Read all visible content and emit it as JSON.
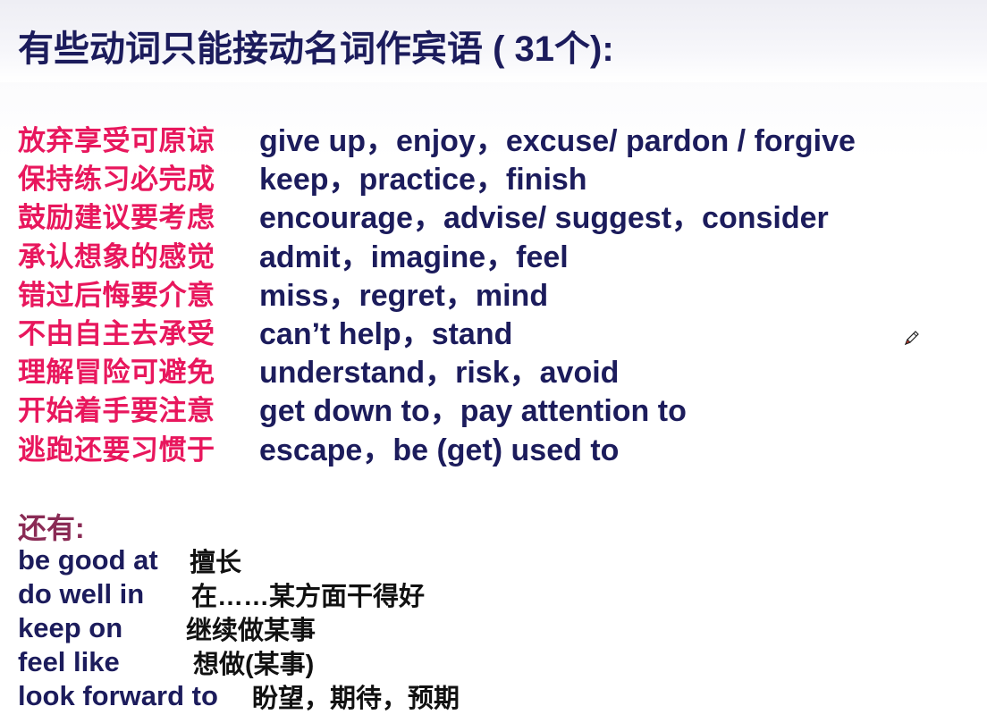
{
  "title": "有些动词只能接动名词作宾语 ( 31个):",
  "rows": [
    {
      "mnemonic": "放弃享受可原谅",
      "verbs": "give up，enjoy，excuse/ pardon / forgive"
    },
    {
      "mnemonic": "保持练习必完成",
      "verbs": "keep，practice，finish"
    },
    {
      "mnemonic": "鼓励建议要考虑",
      "verbs": "encourage，advise/ suggest，consider"
    },
    {
      "mnemonic": "承认想象的感觉",
      "verbs": "admit，imagine，feel"
    },
    {
      "mnemonic": "错过后悔要介意",
      "verbs": "miss，regret，mind"
    },
    {
      "mnemonic": "不由自主去承受",
      "verbs": "can’t help，stand"
    },
    {
      "mnemonic": "理解冒险可避免",
      "verbs": "understand，risk，avoid"
    },
    {
      "mnemonic": "开始着手要注意",
      "verbs": "get down to，pay attention to"
    },
    {
      "mnemonic": "逃跑还要习惯于",
      "verbs": "escape，be (get) used to"
    }
  ],
  "more": {
    "heading": "还有:",
    "items": [
      {
        "phrase": "be good at",
        "meaning": "擅长"
      },
      {
        "phrase": "do well in",
        "meaning": "在……某方面干得好"
      },
      {
        "phrase": "keep on",
        "meaning": "继续做某事"
      },
      {
        "phrase": "feel like",
        "meaning": "想做(某事)"
      },
      {
        "phrase": "look forward to",
        "meaning": "盼望，期待，预期"
      }
    ]
  },
  "colors": {
    "title": "#1c1c5c",
    "mnemonic": "#e8175d",
    "verbs": "#1c1c5c",
    "more_heading": "#8a2b55"
  },
  "icons": [
    "pencil-cursor-icon"
  ]
}
